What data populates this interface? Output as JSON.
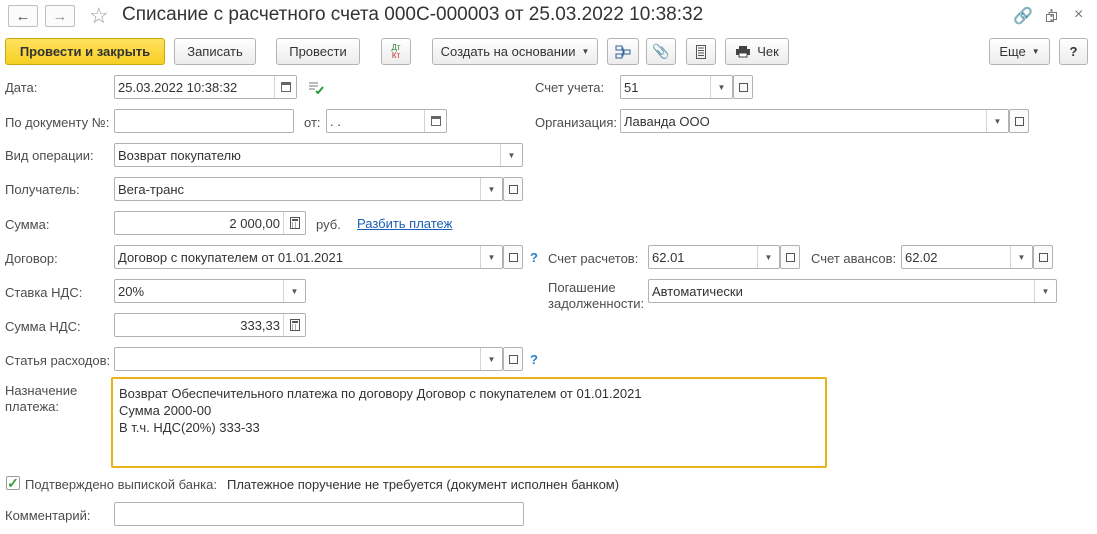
{
  "window": {
    "title": "Списание с расчетного счета 000С-000003 от 25.03.2022 10:38:32",
    "link_icon": "link-icon",
    "menu_icon": "more-vert-icon",
    "restore_icon": "window-restore-icon",
    "close_icon": "close-icon"
  },
  "toolbar": {
    "post_close": "Провести и закрыть",
    "save": "Записать",
    "post": "Провести",
    "dt_kt": "Дт Кт",
    "create_based_on": "Создать на основании",
    "cheque": "Чек",
    "more": "Еще",
    "help": "?"
  },
  "form": {
    "date_label": "Дата:",
    "date_value": "25.03.2022 10:38:32",
    "account_label": "Счет учета:",
    "account_value": "51",
    "doc_no_label": "По документу №:",
    "doc_no_value": "",
    "from_label": "от:",
    "from_value": " .  .",
    "org_label": "Организация:",
    "org_value": "Лаванда ООО",
    "op_type_label": "Вид операции:",
    "op_type_value": "Возврат покупателю",
    "recipient_label": "Получатель:",
    "recipient_value": "Вега-транс",
    "amount_label": "Сумма:",
    "amount_value": "2 000,00",
    "currency": "руб.",
    "split_link": "Разбить платеж",
    "contract_label": "Договор:",
    "contract_value": "Договор с покупателем от 01.01.2021",
    "settle_acc_label": "Счет расчетов:",
    "settle_acc_value": "62.01",
    "adv_acc_label": "Счет авансов:",
    "adv_acc_value": "62.02",
    "vat_rate_label": "Ставка НДС:",
    "vat_rate_value": "20%",
    "debt_label_1": "Погашение",
    "debt_label_2": "задолженности:",
    "debt_value": "Автоматически",
    "vat_sum_label": "Сумма НДС:",
    "vat_sum_value": "333,33",
    "expense_label": "Статья расходов:",
    "expense_value": "",
    "purpose_label_1": "Назначение",
    "purpose_label_2": "платежа:",
    "purpose_lines": [
      "Возврат Обеспечительного платежа по договору Договор с покупателем от 01.01.2021",
      "Сумма 2000-00",
      "В т.ч. НДС(20%) 333-33"
    ],
    "confirmed_label": "Подтверждено выпиской банка:",
    "confirmed_checked": true,
    "confirmed_note": "Платежное поручение не требуется (документ исполнен банком)",
    "comment_label": "Комментарий:",
    "comment_value": "",
    "help_mark": "?"
  }
}
